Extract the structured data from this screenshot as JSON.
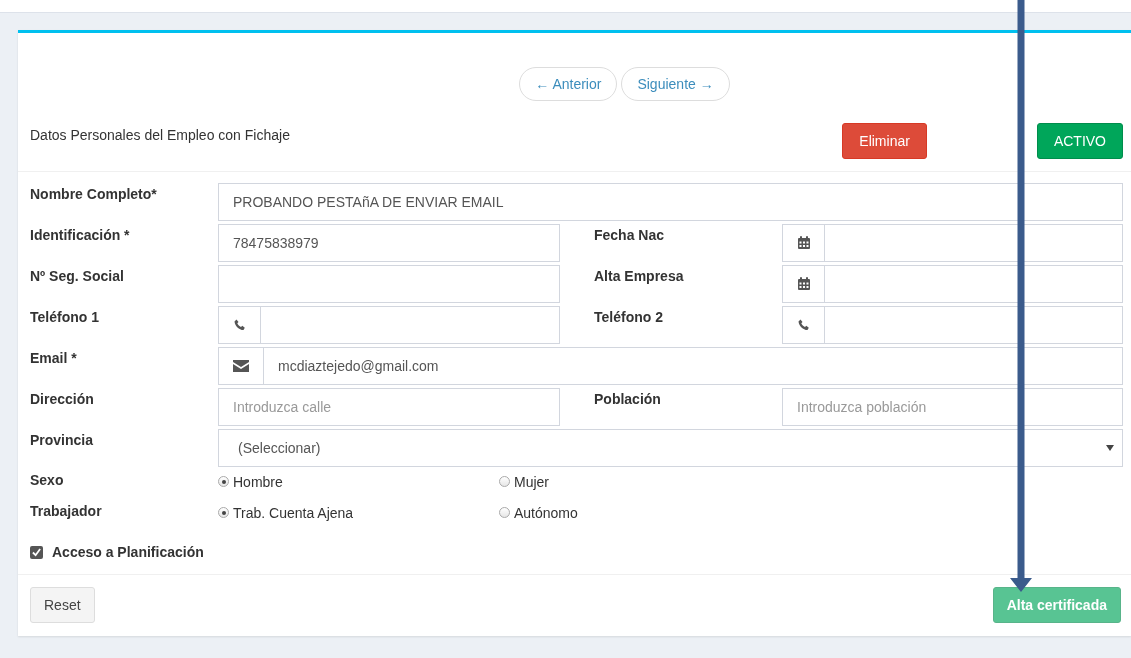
{
  "nav": [
    {
      "label": "← Anterior"
    },
    {
      "label": "Siguiente →"
    }
  ],
  "title": "Datos Personales del Empleo con Fichaje",
  "delete_button": "Eliminar",
  "status_button": {
    "label": "ACTIVO",
    "active": true
  },
  "rows": [
    {
      "cells": [
        {
          "label": "Nombre Completo*",
          "kind": "text",
          "value": "PROBANDO PESTAñA DE ENVIAR EMAIL"
        }
      ]
    },
    {
      "cells": [
        {
          "label": "Identificación *",
          "kind": "text",
          "value": "78475838979"
        },
        {
          "label": "Fecha Nac",
          "kind": "date"
        }
      ]
    },
    {
      "cells": [
        {
          "label": "Nº Seg. Social",
          "kind": "text"
        },
        {
          "label": "Alta Empresa",
          "kind": "date"
        }
      ]
    },
    {
      "cells": [
        {
          "label": "Teléfono 1",
          "kind": "phone"
        },
        {
          "label": "Teléfono 2",
          "kind": "phone"
        }
      ]
    },
    {
      "cells": [
        {
          "label": "Email *",
          "kind": "email",
          "value": "mcdiaztejedo@gmail.com"
        }
      ]
    },
    {
      "cells": [
        {
          "label": "Dirección",
          "kind": "text",
          "placeholder": "Introduzca calle"
        },
        {
          "label": "Población",
          "kind": "text",
          "placeholder": "Introduzca población"
        }
      ]
    },
    {
      "cells": [
        {
          "label": "Provincia",
          "kind": "select",
          "value": "(Seleccionar)"
        }
      ]
    }
  ],
  "radio_groups": [
    {
      "label": "Sexo",
      "options": [
        {
          "label": "Hombre",
          "selected": true
        },
        {
          "label": "Mujer",
          "selected": false
        }
      ]
    },
    {
      "label": "Trabajador",
      "options": [
        {
          "label": "Trab. Cuenta Ajena",
          "selected": true
        },
        {
          "label": "Autónomo",
          "selected": false
        }
      ]
    }
  ],
  "checkbox": {
    "label": "Acceso a Planificación",
    "checked": true
  },
  "reset_button": "Reset",
  "submit_button": {
    "label": "Alta certificada",
    "disabled": true
  }
}
